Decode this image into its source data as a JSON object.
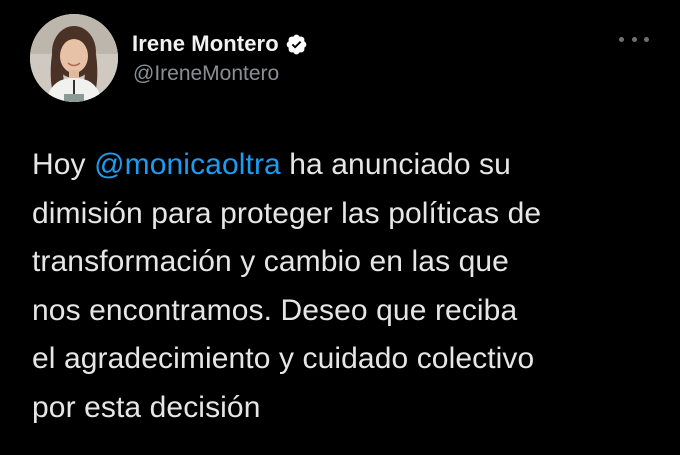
{
  "author": {
    "display_name": "Irene Montero",
    "handle": "@IreneMontero",
    "verified_icon": "verified-badge-icon",
    "avatar_icon": "profile-avatar"
  },
  "menu": {
    "icon": "more-options-icon"
  },
  "tweet": {
    "lines": [
      {
        "before": "Hoy ",
        "mention": "@monicaoltra",
        "after": " ha anunciado su"
      },
      {
        "text": "dimisión para proteger las políticas de"
      },
      {
        "text": "transformación y cambio en las que"
      },
      {
        "text": "nos encontramos. Deseo que reciba"
      },
      {
        "text": "el agradecimiento y cuidado colectivo"
      },
      {
        "text": "por esta decisión"
      }
    ]
  },
  "colors": {
    "background": "#000000",
    "text": "#e7e9ea",
    "handle": "#8b8f93",
    "mention": "#1d9bf0",
    "verified_badge": "#ffffff"
  }
}
